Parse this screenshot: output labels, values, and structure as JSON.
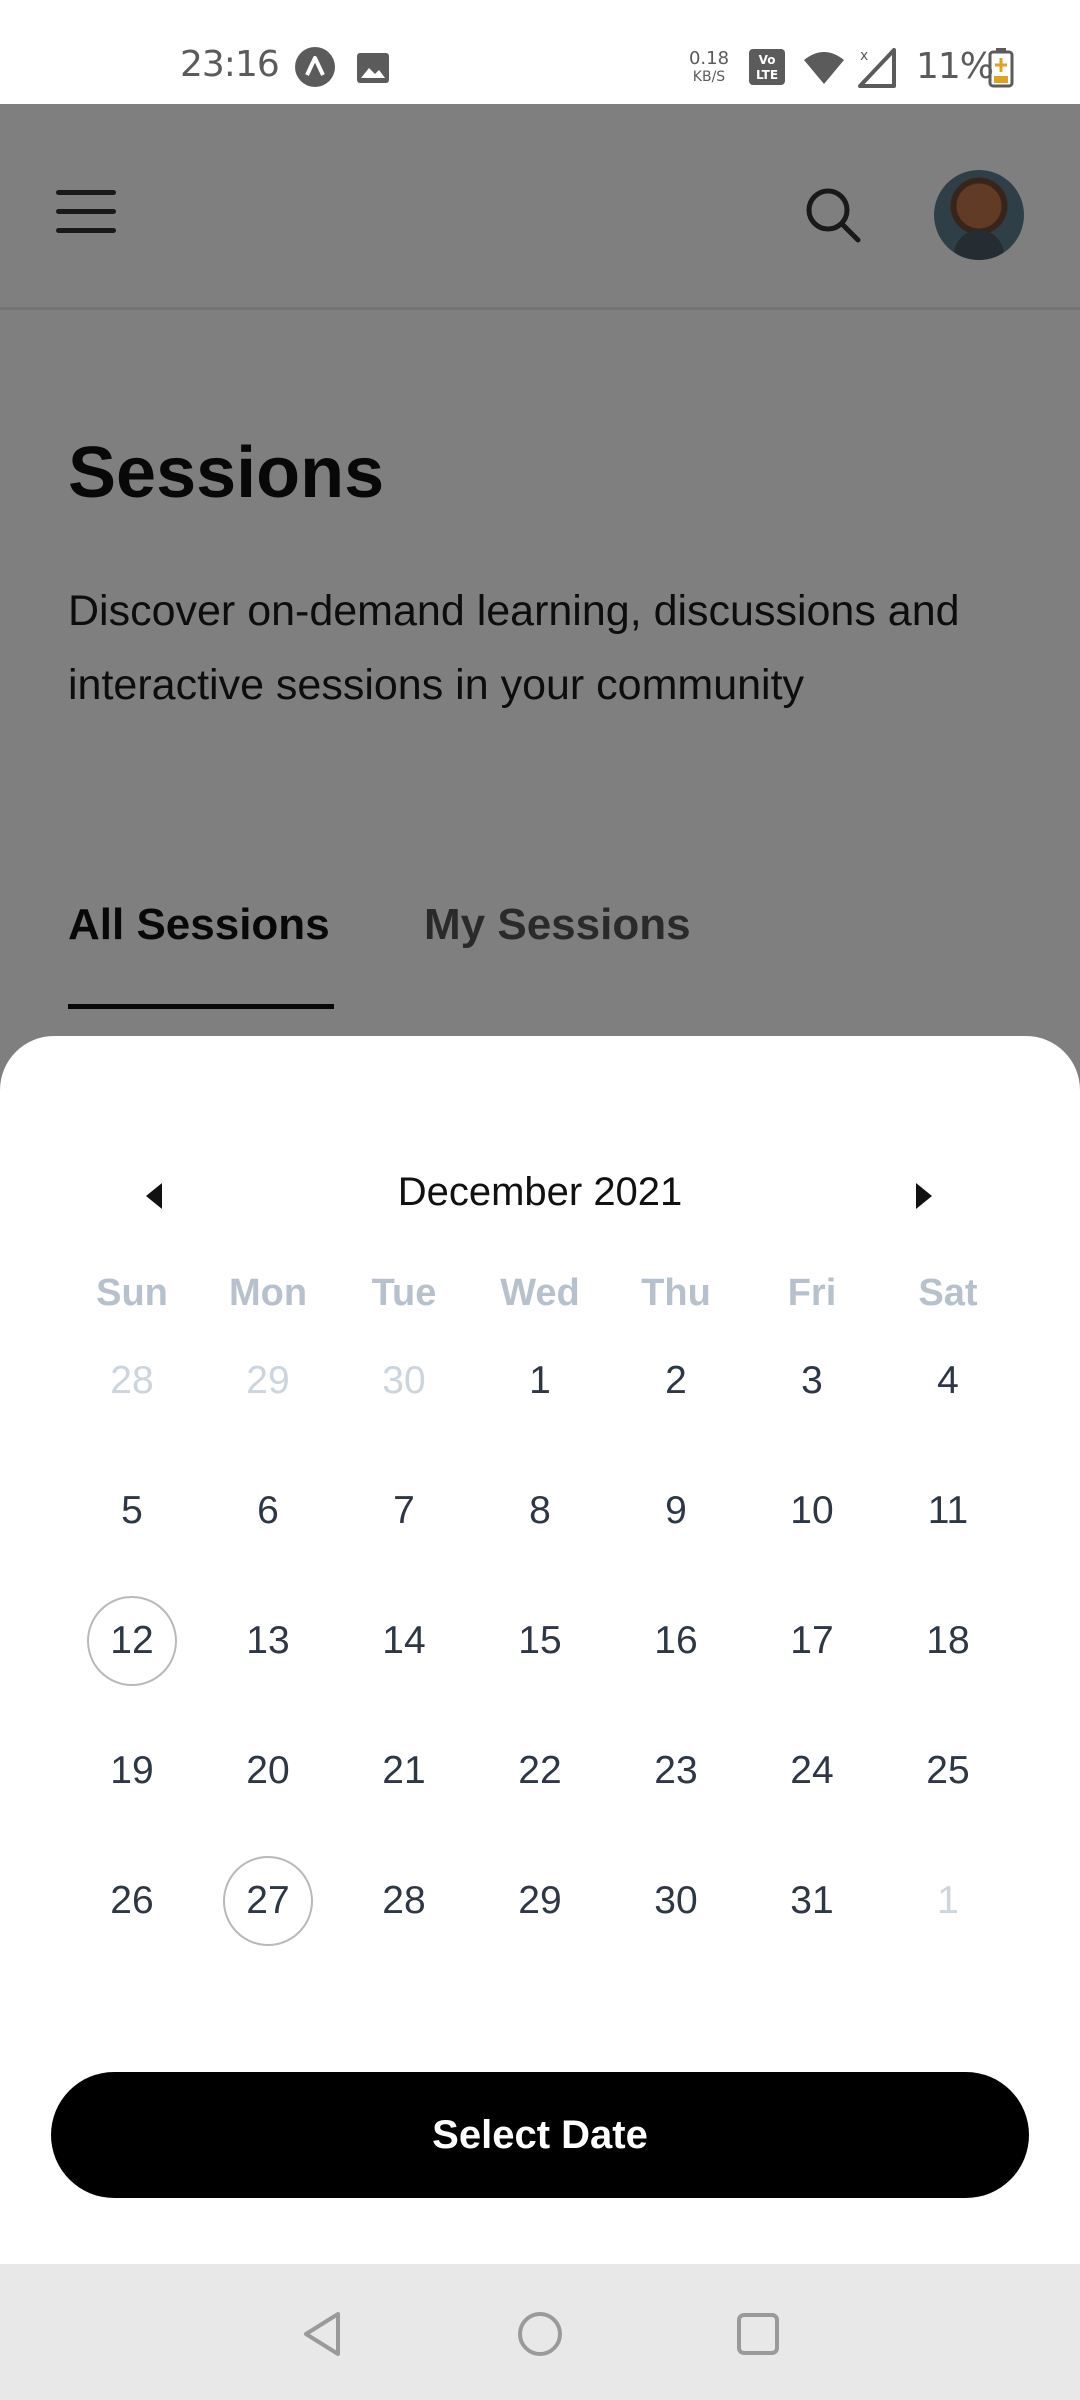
{
  "status_bar": {
    "time": "23:16",
    "net_speed_value": "0.18",
    "net_speed_unit": "KB/S",
    "volte_label": "Vo LTE",
    "battery": "11%",
    "icons": [
      "a-app-icon",
      "image-icon",
      "volte-icon",
      "wifi-icon",
      "signal-icon",
      "battery-icon"
    ]
  },
  "header": {
    "menu_icon": "hamburger-menu-icon",
    "search_icon": "search-icon",
    "avatar": "user-avatar"
  },
  "page": {
    "title": "Sessions",
    "description": "Discover on-demand learning, discussions and interactive sessions in your community"
  },
  "tabs": [
    {
      "label": "All Sessions",
      "active": true
    },
    {
      "label": "My Sessions",
      "active": false
    }
  ],
  "calendar": {
    "month_label": "December 2021",
    "prev_icon": "caret-left-icon",
    "next_icon": "caret-right-icon",
    "weekdays": [
      "Sun",
      "Mon",
      "Tue",
      "Wed",
      "Thu",
      "Fri",
      "Sat"
    ],
    "weeks": [
      [
        {
          "d": "28",
          "m": true
        },
        {
          "d": "29",
          "m": true
        },
        {
          "d": "30",
          "m": true
        },
        {
          "d": "1"
        },
        {
          "d": "2"
        },
        {
          "d": "3"
        },
        {
          "d": "4"
        }
      ],
      [
        {
          "d": "5"
        },
        {
          "d": "6"
        },
        {
          "d": "7"
        },
        {
          "d": "8"
        },
        {
          "d": "9"
        },
        {
          "d": "10"
        },
        {
          "d": "11"
        }
      ],
      [
        {
          "d": "12",
          "r": true
        },
        {
          "d": "13"
        },
        {
          "d": "14"
        },
        {
          "d": "15"
        },
        {
          "d": "16"
        },
        {
          "d": "17"
        },
        {
          "d": "18"
        }
      ],
      [
        {
          "d": "19"
        },
        {
          "d": "20"
        },
        {
          "d": "21"
        },
        {
          "d": "22"
        },
        {
          "d": "23"
        },
        {
          "d": "24"
        },
        {
          "d": "25"
        }
      ],
      [
        {
          "d": "26"
        },
        {
          "d": "27",
          "r": true
        },
        {
          "d": "28"
        },
        {
          "d": "29"
        },
        {
          "d": "30"
        },
        {
          "d": "31"
        },
        {
          "d": "1",
          "m": true
        }
      ]
    ],
    "select_button": "Select Date"
  },
  "nav_bar": {
    "icons": [
      "back-triangle-icon",
      "home-circle-icon",
      "recents-square-icon"
    ]
  }
}
